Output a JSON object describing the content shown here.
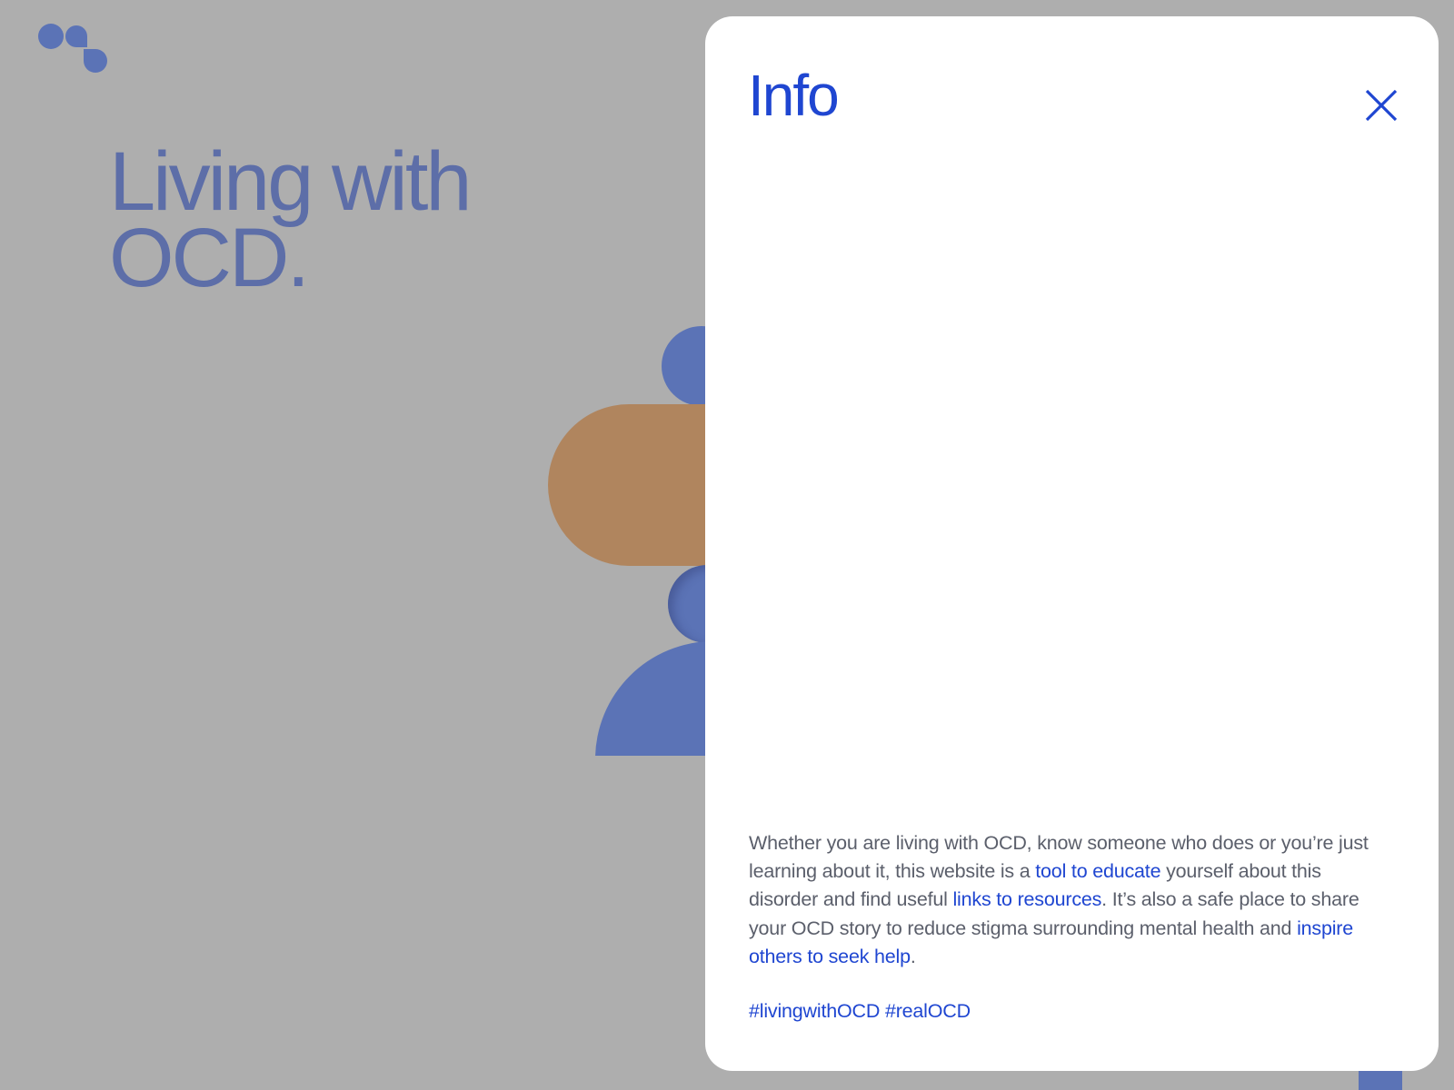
{
  "page": {
    "hero_title_line1": "Living with",
    "hero_title_line2": "OCD."
  },
  "info_panel": {
    "title": "Info",
    "close_icon": "close-icon",
    "paragraph": {
      "seg1": "Whether you are living with OCD, know someone who does or you’re just learning about it, this website is a ",
      "link1": "tool to educate",
      "seg2": " yourself about this disorder and find useful ",
      "link2": "links to resources",
      "seg3": ". It’s also a safe place to share your OCD story to reduce stigma surrounding mental health and ",
      "link3": "inspire others to seek help",
      "seg4": "."
    },
    "hashtags": [
      "#livingwithOCD",
      "#realOCD"
    ]
  },
  "colors": {
    "background": "#aeaeae",
    "accent_blue": "#1f46d1",
    "shape_blue": "#5b73b6",
    "shape_tan": "#b0855e",
    "body_text": "#5b5f6b"
  }
}
